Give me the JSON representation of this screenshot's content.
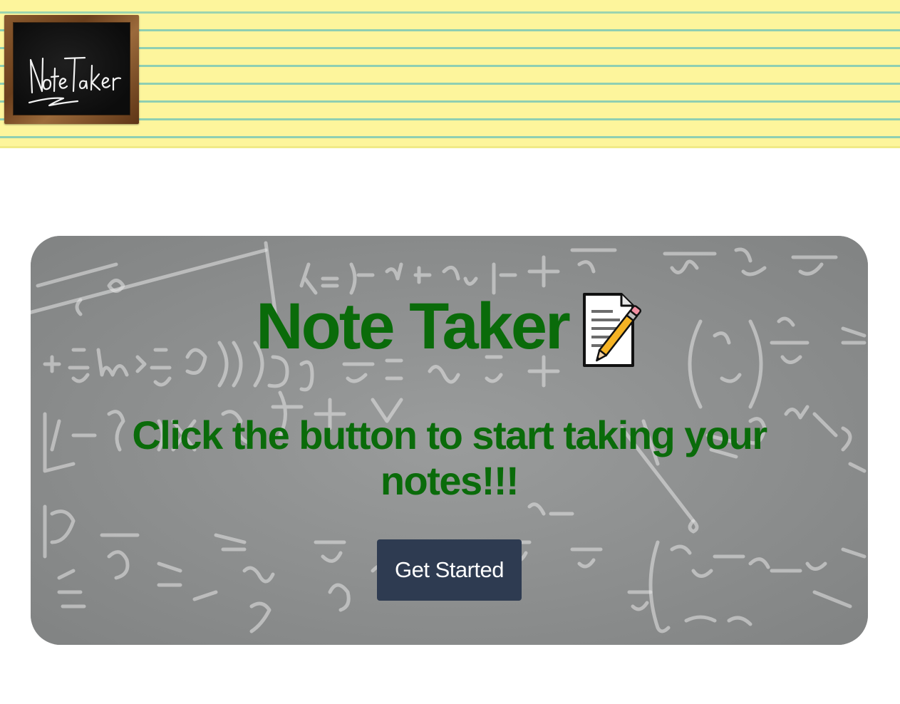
{
  "header": {
    "logo_text": "Note Taker"
  },
  "hero": {
    "title": "Note Taker",
    "title_icon": "memo-pencil-icon",
    "subtitle": "Click the button to start taking your notes!!!",
    "button_label": "Get Started"
  },
  "colors": {
    "header_paper": "#fdf59c",
    "paper_lines": "#8fcfb2",
    "hero_background": "#8d8f8f",
    "hero_text": "#0a6b0a",
    "button_background": "#2e3b51",
    "button_text": "#ffffff"
  }
}
